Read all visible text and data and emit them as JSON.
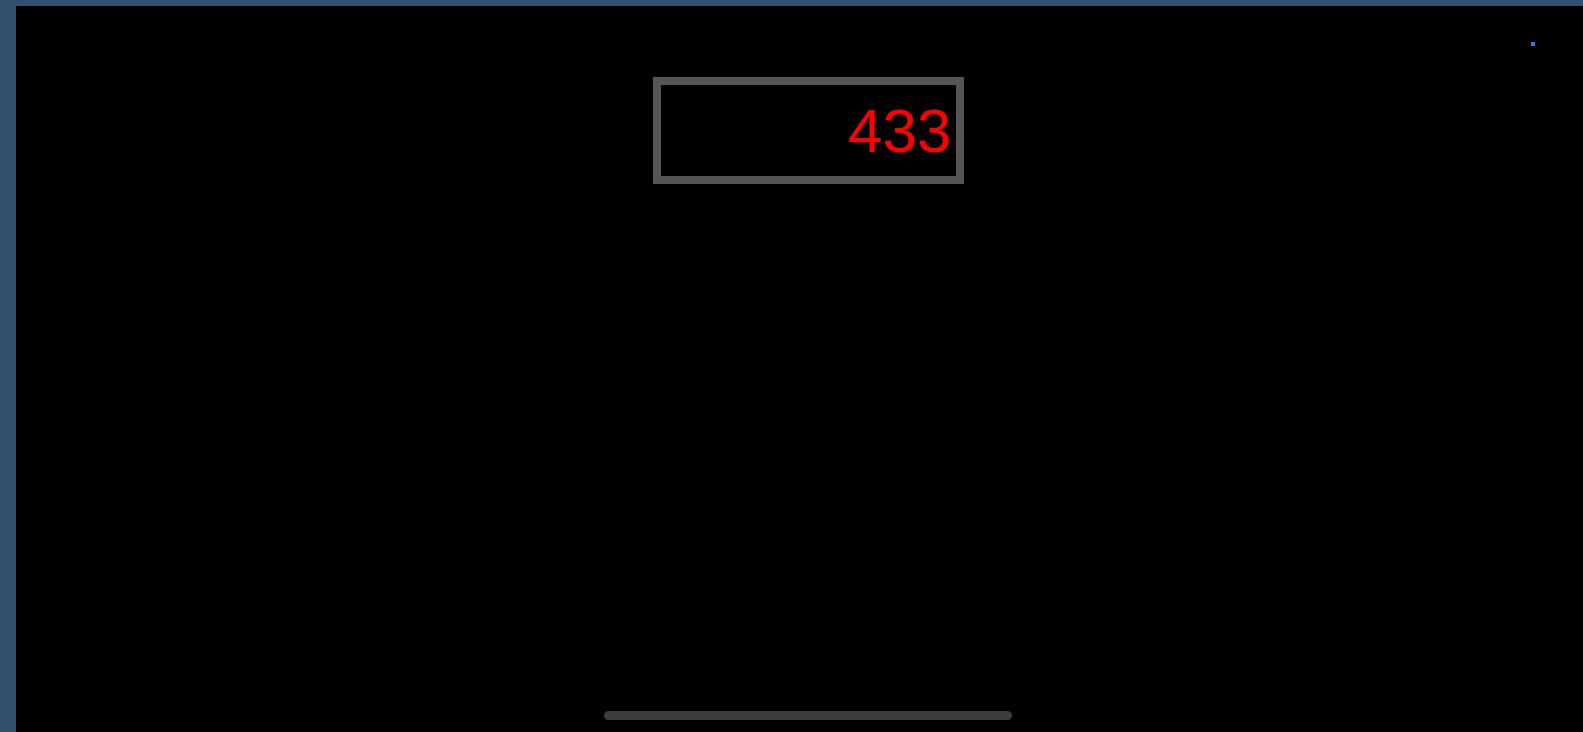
{
  "display": {
    "value": "433"
  }
}
